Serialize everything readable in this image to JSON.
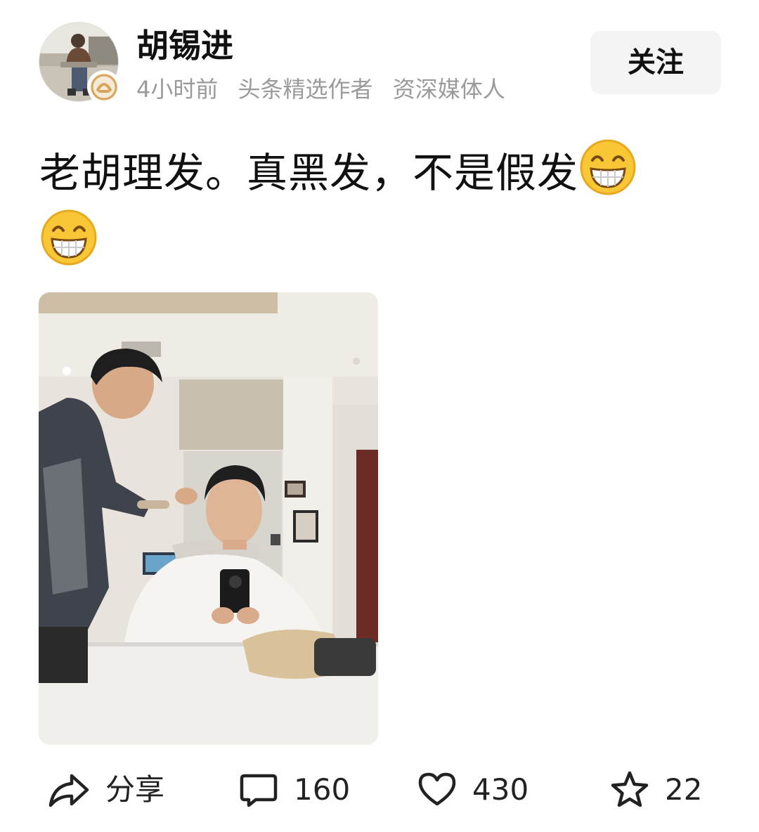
{
  "author": {
    "name": "胡锡进",
    "avatar": "avatar-photo",
    "verified_icon": "verified-badge-icon"
  },
  "meta": {
    "time": "4小时前",
    "badges": [
      "头条精选作者",
      "资深媒体人"
    ]
  },
  "follow_label": "关注",
  "post": {
    "text": "老胡理发。真黑发，不是假发",
    "emoji": "grinning-face-emoji",
    "emoji_count": 2,
    "image": "barbershop-selfie-photo"
  },
  "actions": {
    "share": {
      "icon": "share-icon",
      "label": "分享"
    },
    "comment": {
      "icon": "comment-icon",
      "label": "160"
    },
    "like": {
      "icon": "heart-icon",
      "label": "430"
    },
    "favorite": {
      "icon": "star-icon",
      "label": "22"
    }
  },
  "colors": {
    "text": "#111111",
    "meta": "#9a9a9a",
    "follow_bg": "#f4f4f4",
    "badge_gold": "#d9a55a",
    "emoji_yellow": "#f9c635"
  }
}
